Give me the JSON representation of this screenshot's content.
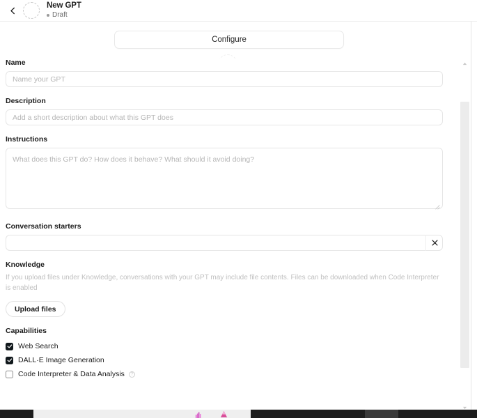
{
  "header": {
    "back_icon": "chevron-left-icon",
    "avatar": "dashed-circle-avatar-placeholder",
    "title": "New GPT",
    "status": "Draft",
    "status_dot_color": "#9a9a9a"
  },
  "tabs": {
    "configure_label": "Configure",
    "active": "Configure"
  },
  "form": {
    "name": {
      "label": "Name",
      "value": "",
      "placeholder": "Name your GPT"
    },
    "description": {
      "label": "Description",
      "value": "",
      "placeholder": "Add a short description about what this GPT does"
    },
    "instructions": {
      "label": "Instructions",
      "value": "",
      "placeholder": "What does this GPT do? How does it behave? What should it avoid doing?"
    },
    "conversation_starters": {
      "label": "Conversation starters",
      "rows": [
        {
          "value": "",
          "placeholder": "",
          "remove_icon": "close-icon"
        }
      ]
    },
    "knowledge": {
      "label": "Knowledge",
      "help_text": "If you upload files under Knowledge, conversations with your GPT may include file contents. Files can be downloaded when Code Interpreter is enabled",
      "upload_label": "Upload files"
    },
    "capabilities": {
      "label": "Capabilities",
      "items": [
        {
          "label": "Web Search",
          "checked": true,
          "info": false
        },
        {
          "label": "DALL·E Image Generation",
          "checked": true,
          "info": false
        },
        {
          "label": "Code Interpreter & Data Analysis",
          "checked": false,
          "info": true,
          "info_glyph": "?"
        }
      ]
    }
  },
  "scrollbar": {
    "up_icon": "caret-up-icon",
    "down_icon": "caret-down-icon",
    "thumb": "scroll-thumb"
  },
  "colors": {
    "checkbox_checked": "#11181c",
    "border": "#e6e6e6",
    "placeholder": "#b6b6b6",
    "help_text": "#c0c0c0",
    "scroll_thumb": "#ececec"
  }
}
